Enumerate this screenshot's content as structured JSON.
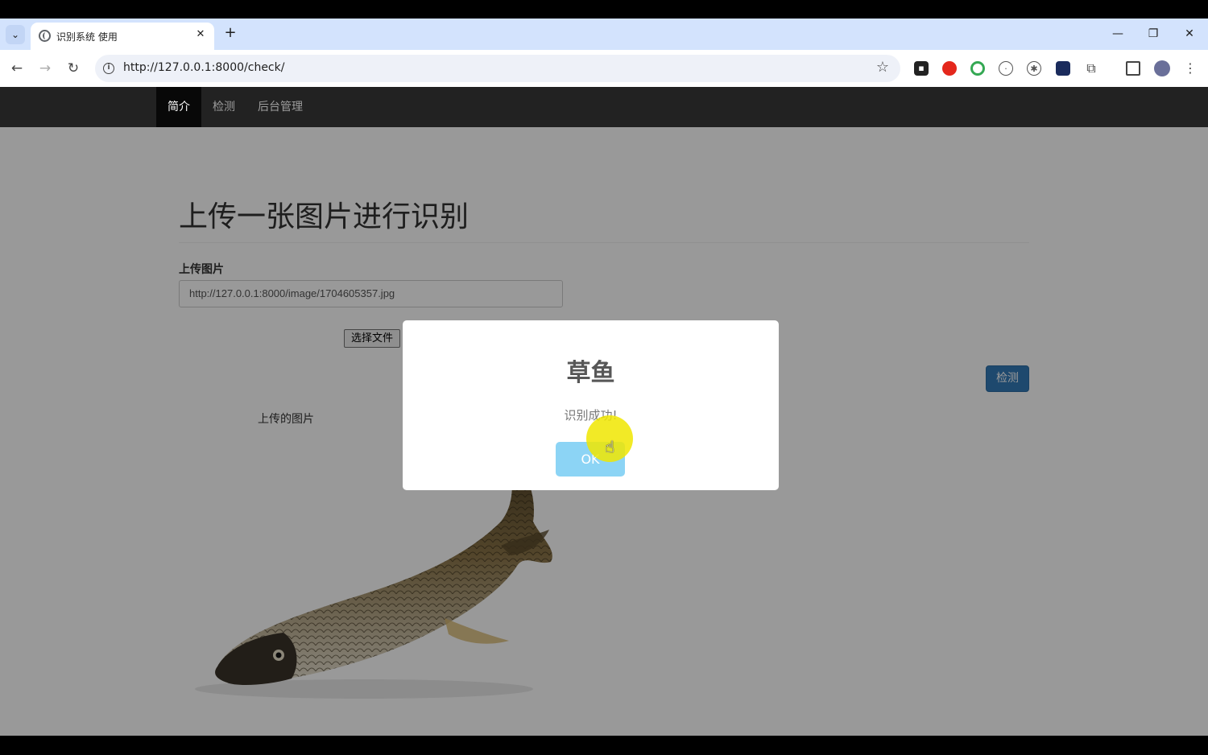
{
  "browser": {
    "tab_title": "识别系统 使用",
    "tab_close": "✕",
    "new_tab": "+",
    "url": "http://127.0.0.1:8000/check/",
    "window_controls": [
      "—",
      "❐",
      "✕"
    ]
  },
  "navbar": {
    "items": [
      "简介",
      "检测",
      "后台管理"
    ],
    "active_index": 0
  },
  "main": {
    "heading": "上传一张图片进行识别",
    "upload_label": "上传图片",
    "image_url_value": "http://127.0.0.1:8000/image/1704605357.jpg",
    "choose_file_label": "选择文件",
    "detect_label": "检测",
    "uploaded_image_label": "上传的图片"
  },
  "dialog": {
    "title": "草鱼",
    "message": "识别成功!",
    "ok_label": "OK",
    "ok_color": "#8cd4f5"
  },
  "colors": {
    "navbar_bg": "#222222",
    "primary_button": "#337ab7",
    "tabstrip_bg": "#d3e3fd"
  }
}
